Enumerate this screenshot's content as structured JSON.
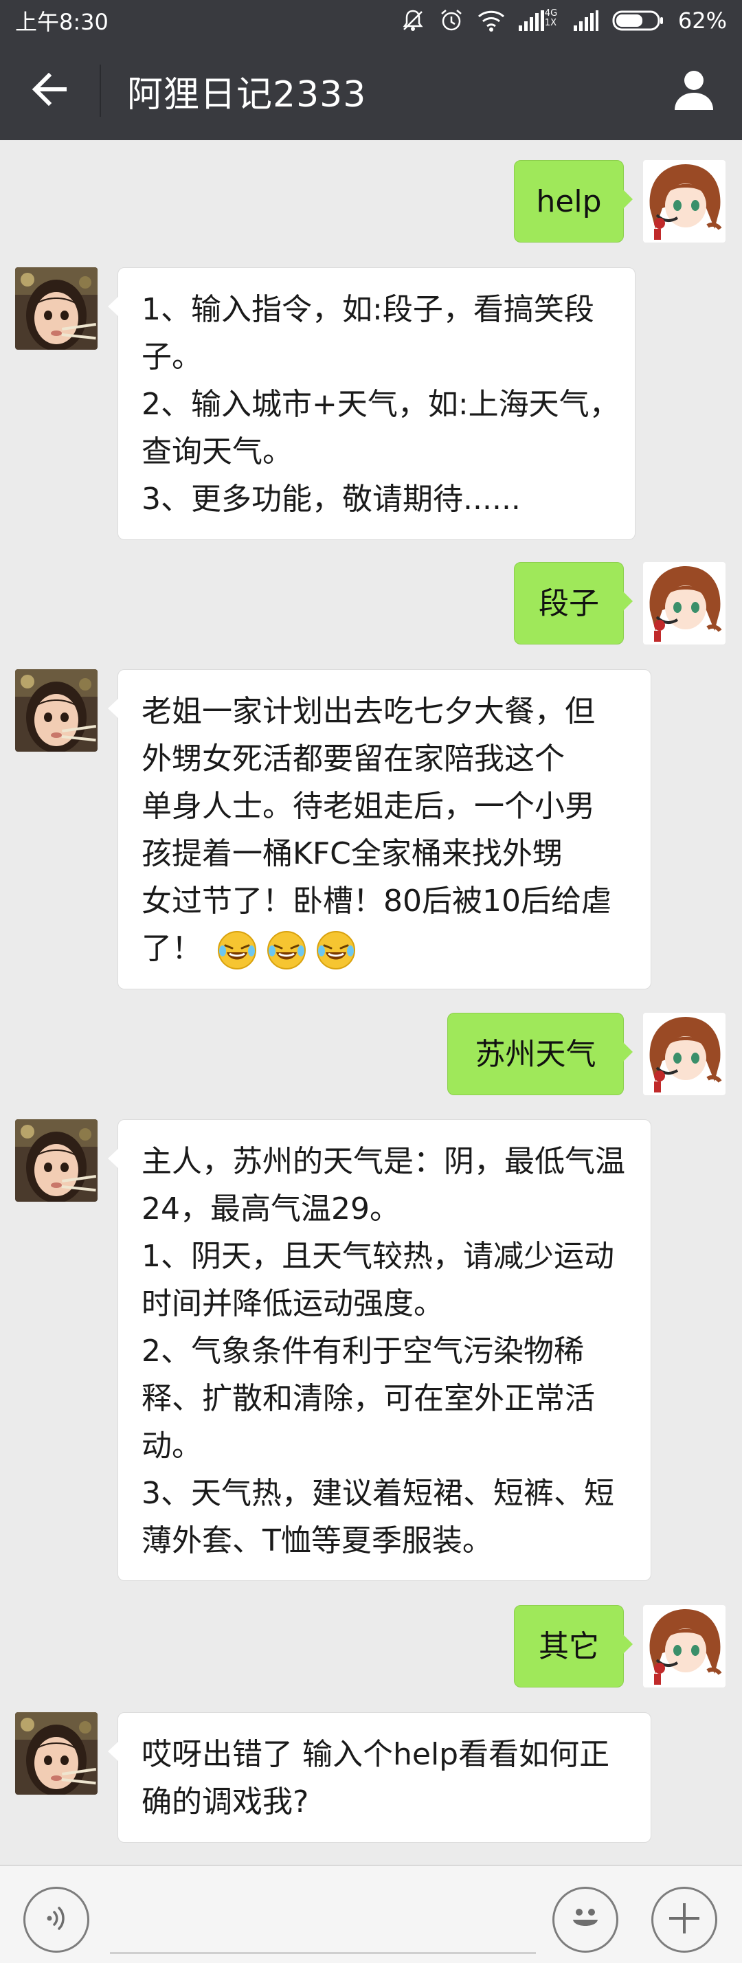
{
  "status_bar": {
    "time": "上午8:30",
    "network_small_top": "4G",
    "network_small_bottom": "1X",
    "battery": "62%",
    "icons": [
      "mute-icon",
      "alarm-icon",
      "wifi-icon",
      "signal-icon",
      "signal-icon",
      "battery-icon"
    ]
  },
  "header": {
    "title": "阿狸日记2333",
    "back_icon": "back-arrow-icon",
    "profile_icon": "person-icon"
  },
  "messages": [
    {
      "from": "me",
      "text": "help"
    },
    {
      "from": "bot",
      "lines": [
        "1、输入指令，如:段子，看搞笑段",
        "子。",
        "2、输入城市+天气，如:上海天气，",
        "查询天气。",
        "3、更多功能，敬请期待......"
      ]
    },
    {
      "from": "me",
      "text": "段子"
    },
    {
      "from": "bot",
      "lines": [
        "老姐一家计划出去吃七夕大餐，但",
        "外甥女死活都要留在家陪我这个",
        "单身人士。待老姐走后，一个小男",
        "孩提着一桶KFC全家桶来找外甥",
        "女过节了！卧槽！80后被10后给虐",
        "了！"
      ],
      "emoji": [
        "laughing-crying-emoji",
        "laughing-crying-emoji",
        "laughing-crying-emoji"
      ]
    },
    {
      "from": "me",
      "text": "苏州天气"
    },
    {
      "from": "bot",
      "lines": [
        "主人，苏州的天气是：阴，最低气温",
        "24，最高气温29。",
        "1、阴天，且天气较热，请减少运动",
        "时间并降低运动强度。",
        "2、气象条件有利于空气污染物稀",
        "释、扩散和清除，可在室外正常活",
        "动。",
        "3、天气热，建议着短裙、短裤、短",
        "薄外套、T恤等夏季服装。"
      ]
    },
    {
      "from": "me",
      "text": "其它"
    },
    {
      "from": "bot",
      "lines": [
        "哎呀出错了 输入个help看看如何正",
        "确的调戏我?"
      ]
    }
  ],
  "input_bar": {
    "voice_icon": "voice-icon",
    "emoji_icon": "emoji-icon",
    "plus_icon": "plus-icon"
  },
  "colors": {
    "header_bg": "#393a3f",
    "chat_bg": "#ebebeb",
    "outgoing_bubble": "#9fe85a",
    "incoming_bubble": "#ffffff"
  }
}
